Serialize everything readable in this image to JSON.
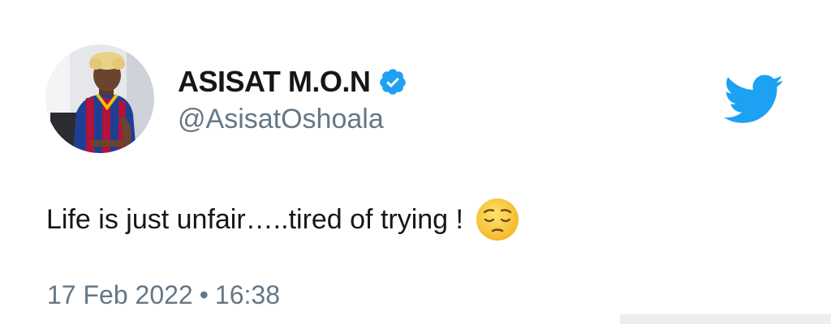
{
  "user": {
    "display_name": "ASISAT M.O.N",
    "handle": "@AsisatOshoala",
    "verified_icon": "verified-badge-icon",
    "avatar_icon": "profile-photo-avatar"
  },
  "tweet": {
    "text": "Life is just unfair…..tired of trying !",
    "emoji_icon": "pensive-face-emoji-icon",
    "date": "17 Feb 2022",
    "separator": "•",
    "time": "16:38"
  },
  "brand": {
    "logo_icon": "twitter-bird-icon",
    "accent_color": "#1da1f2"
  },
  "colors": {
    "primary_text": "#14171a",
    "secondary_text": "#657786"
  }
}
